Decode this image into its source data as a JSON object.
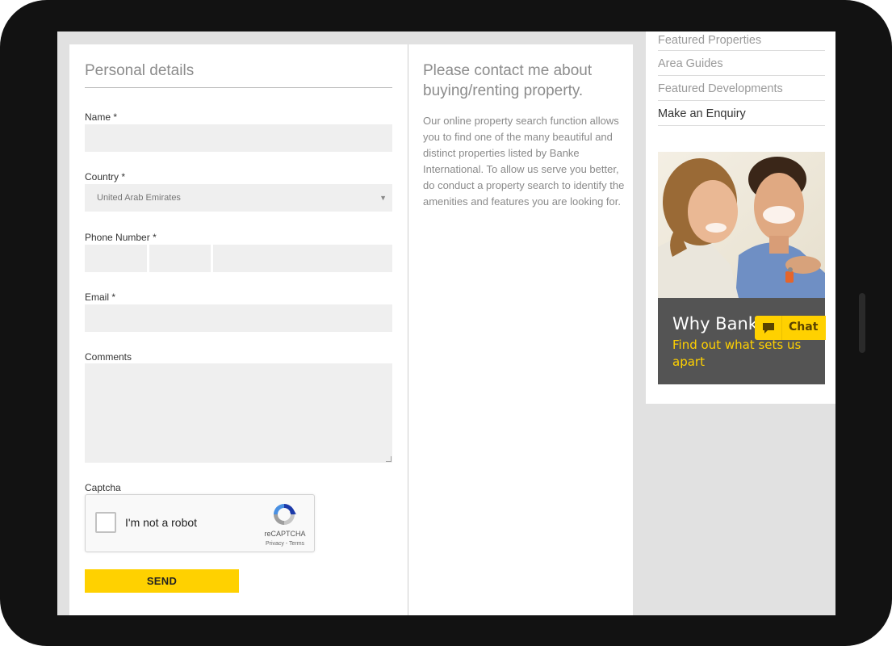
{
  "form": {
    "section_title": "Personal details",
    "name_label": "Name",
    "country_label": "Country",
    "country_value": "United Arab Emirates",
    "phone_label": "Phone Number",
    "email_label": "Email",
    "comments_label": "Comments",
    "captcha_label": "Captcha",
    "required_mark": "*",
    "send_label": "SEND"
  },
  "captcha": {
    "checkbox_text": "I'm not a robot",
    "brand": "reCAPTCHA",
    "links": "Privacy - Terms"
  },
  "info": {
    "title": "Please contact me about buying/renting property.",
    "body": "Our online property search function allows you to find one of the many beautiful and distinct properties listed by Banke International. To allow us serve you better, do conduct a property search to identify the amenities and features you are looking for."
  },
  "sidebar": {
    "items": [
      {
        "label": "Featured Properties",
        "active": false
      },
      {
        "label": "Area Guides",
        "active": false
      },
      {
        "label": "Featured Developments",
        "active": false
      },
      {
        "label": "Make an Enquiry",
        "active": true
      }
    ],
    "promo": {
      "title": "Why Banke",
      "subtitle": "Find out what sets us apart"
    }
  },
  "chat": {
    "label": "Chat",
    "icon": "chat-bubble-icon"
  },
  "colors": {
    "accent": "#ffd100",
    "promo_bg": "#545454",
    "field_bg": "#efefef",
    "page_bg": "#e1e1e1",
    "device_frame": "#121212"
  }
}
